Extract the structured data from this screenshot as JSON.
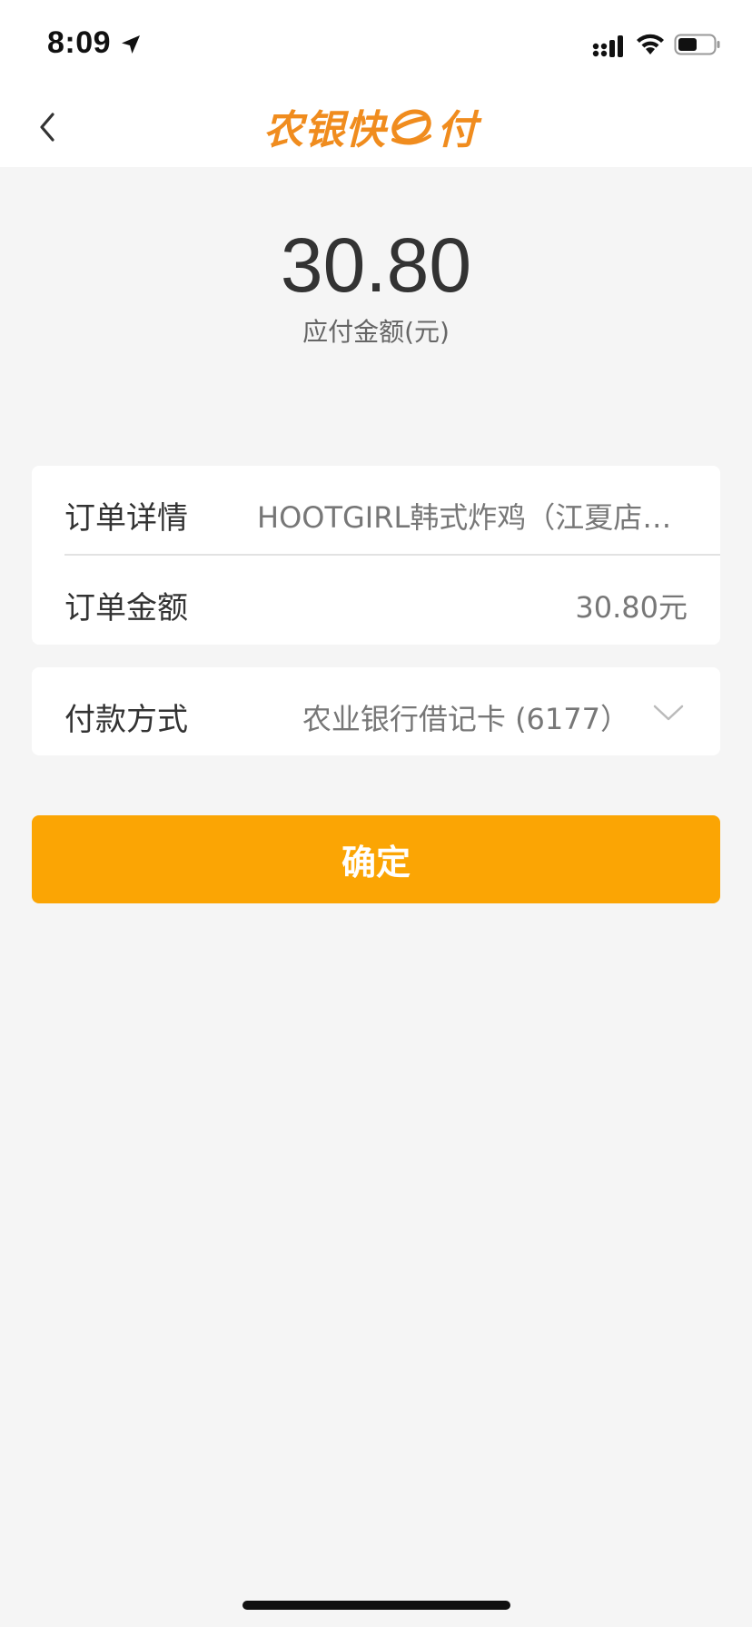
{
  "status_bar": {
    "time": "8:09",
    "icons": [
      "location-arrow-icon",
      "cellular-signal-icon",
      "wifi-icon",
      "battery-icon"
    ],
    "battery_level": 0.5
  },
  "nav": {
    "back_icon": "chevron-left-icon",
    "logo_text_before": "农银快",
    "logo_text_after": "付"
  },
  "amount": {
    "value": "30.80",
    "caption": "应付金额(元)"
  },
  "order_card": {
    "detail_label": "订单详情",
    "detail_value": "HOOTGIRL韩式炸鸡（江夏店…",
    "amount_label": "订单金额",
    "amount_value": "30.80元"
  },
  "payment": {
    "label": "付款方式",
    "method": "农业银行借记卡 (6177）",
    "dropdown_icon": "chevron-down-icon"
  },
  "confirm_button": {
    "label": "确定"
  },
  "colors": {
    "accent": "#fba504",
    "logo": "#f08c1e",
    "background": "#f5f5f5",
    "card": "#ffffff"
  }
}
